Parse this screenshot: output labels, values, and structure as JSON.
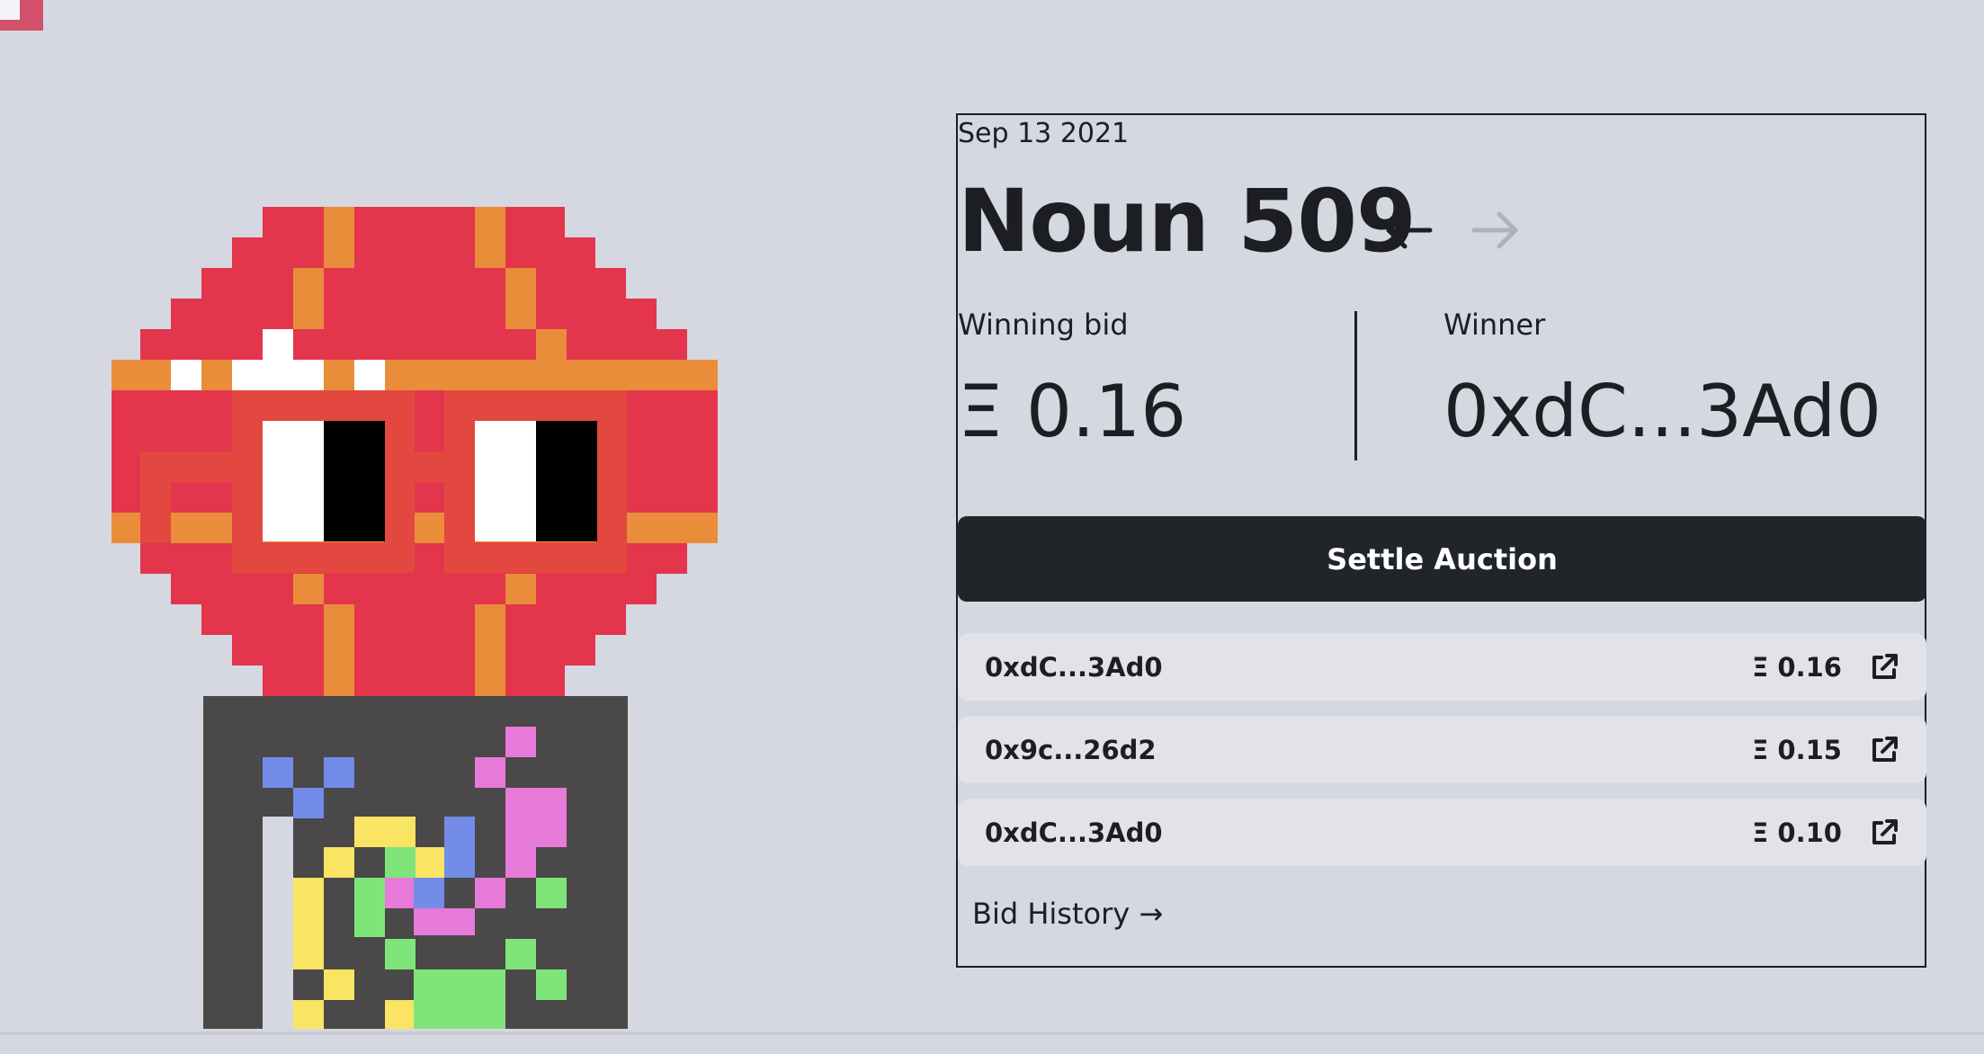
{
  "auction": {
    "date": "Sep 13 2021",
    "title": "Noun 509",
    "winning_bid_label": "Winning bid",
    "winning_bid_value": "Ξ 0.16",
    "winner_label": "Winner",
    "winner_value": "0xdC...3Ad0",
    "settle_label": "Settle Auction",
    "history_label": "Bid History →"
  },
  "bids": [
    {
      "address": "0xdC...3Ad0",
      "amount": "Ξ 0.16"
    },
    {
      "address": "0x9c...26d2",
      "amount": "Ξ 0.15"
    },
    {
      "address": "0xdC...3Ad0",
      "amount": "Ξ 0.10"
    }
  ],
  "icons": [
    "arrow-left-icon",
    "arrow-right-icon",
    "external-link-icon"
  ],
  "colors": {
    "background": "#d5d7e1",
    "button": "#212529",
    "noun_red": "#e3354c",
    "noun_orange": "#ea8d3a"
  }
}
